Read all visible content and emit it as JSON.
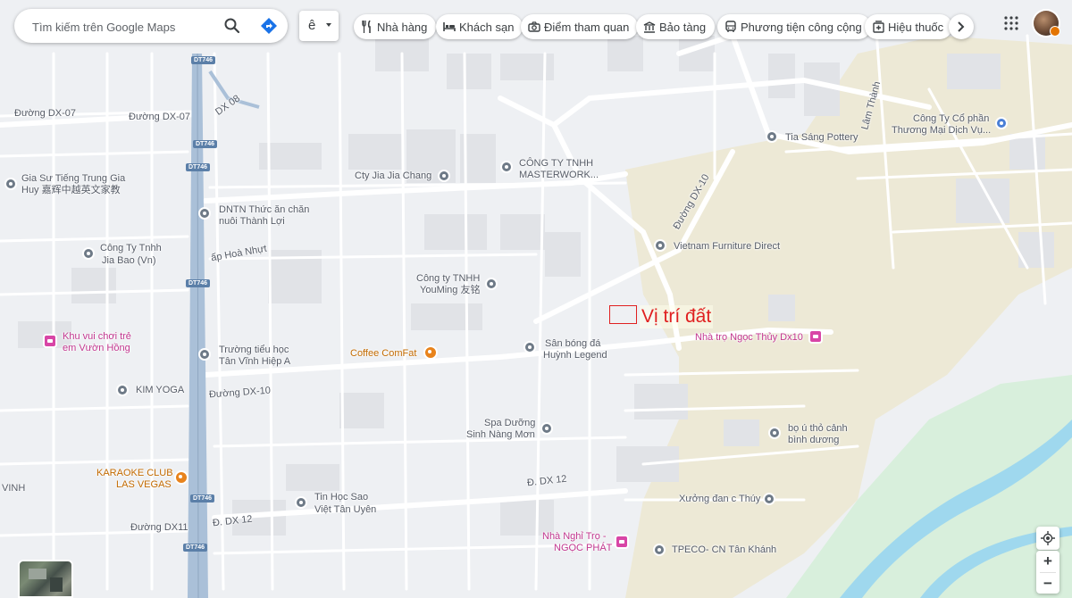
{
  "search": {
    "placeholder": "Tìm kiếm trên Google Maps"
  },
  "language_button": {
    "label": "ê"
  },
  "categories": [
    {
      "label": "Nhà hàng",
      "icon": "fork-knife-icon"
    },
    {
      "label": "Khách sạn",
      "icon": "bed-icon"
    },
    {
      "label": "Điểm tham quan",
      "icon": "camera-icon"
    },
    {
      "label": "Bảo tàng",
      "icon": "museum-icon"
    },
    {
      "label": "Phương tiện công cộng",
      "icon": "bus-icon"
    },
    {
      "label": "Hiệu thuốc",
      "icon": "pharmacy-icon"
    }
  ],
  "annotation": {
    "label": "Vị trí đất",
    "color": "#e02020"
  },
  "road_shields": [
    "DT746",
    "DT746",
    "DT746",
    "DT746",
    "DT746",
    "DT746",
    "DT746",
    "DT746"
  ],
  "roads": {
    "dx07_a": "Đường DX-07",
    "dx07_b": "Đường DX-07",
    "dx08": "DX 08",
    "dx10_a": "Đường DX-10",
    "dx10_b": "Đường DX-10",
    "hoa_nhut": "ấp Hoà Nhựt",
    "dx12_a": "Đ. DX 12",
    "dx12_b": "Đ. DX 12",
    "dx11": "Đường DX11",
    "lam_thanh": "Lâm Thành",
    "vinh": "VINH"
  },
  "places": {
    "gia_su_1": "Gia Sư Tiếng Trung Gia",
    "gia_su_2": "Huy 嘉辉中越英文家教",
    "dntn_1": "DNTN Thức ăn chăn",
    "dntn_2": "nuôi Thành Lợi",
    "jia_bao_1": "Công Ty Tnhh",
    "jia_bao_2": "Jia Bao (Vn)",
    "cty_jia": "Cty Jia Jia Chang",
    "masterwork_1": "CÔNG TY TNHH",
    "masterwork_2": "MASTERWORK...",
    "youming_1": "Công ty TNHH",
    "youming_2": "YouMing 友铭",
    "khu_vui_1": "Khu vui chơi trẻ",
    "khu_vui_2": "em Vườn Hồng",
    "truong_1": "Trường tiểu học",
    "truong_2": "Tân Vĩnh Hiệp A",
    "coffee": "Coffee ComFat",
    "san_bong_1": "Sân bóng đá",
    "san_bong_2": "Huỳnh Legend",
    "kim_yoga": "KIM YOGA",
    "spa_1": "Spa Dưỡng",
    "spa_2": "Sinh Nàng Mơn",
    "karaoke_1": "KARAOKE CLUB",
    "karaoke_2": "LAS VEGAS",
    "tin_hoc_1": "Tin Học Sao",
    "tin_hoc_2": "Việt Tân Uyên",
    "nha_nghi_1": "Nhà Nghỉ Trọ -",
    "nha_nghi_2": "NGỌC PHÁT",
    "tpeco": "TPECO- CN Tân Khánh",
    "xuong_dan": "Xưởng đan c Thúy",
    "bo_u_1": "bọ ú thỏ cảnh",
    "bo_u_2": "bình dương",
    "nha_tro": "Nhà trọ Ngọc Thủy Dx10",
    "vietnam_furniture": "Vietnam Furniture Direct",
    "tia_sang": "Tia Sáng Pottery",
    "cty_co_phan_1": "Công Ty Cổ phần",
    "cty_co_phan_2": "Thương Mại Dịch Vụ..."
  },
  "colors": {
    "water": "#9fd8ee",
    "sand": "#ede9d6",
    "green": "#d8efdc",
    "road": "#ffffff",
    "highway": "#aac0d8"
  }
}
